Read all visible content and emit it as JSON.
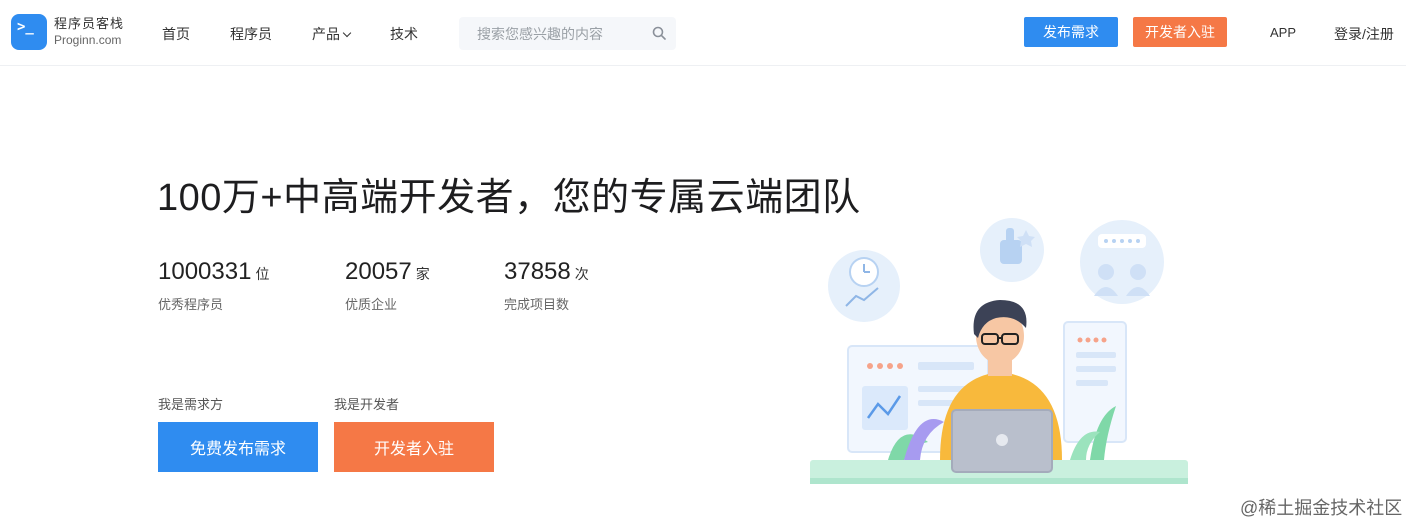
{
  "header": {
    "logo": {
      "name_cn": "程序员客栈",
      "name_en": "Proginn.com",
      "mark_glyph": ">_"
    },
    "nav": [
      {
        "label": "首页"
      },
      {
        "label": "程序员"
      },
      {
        "label": "产品"
      },
      {
        "label": "技术"
      }
    ],
    "search": {
      "placeholder": "搜索您感兴趣的内容",
      "value": ""
    },
    "post_button": "发布需求",
    "join_button": "开发者入驻",
    "app_link": "APP",
    "login_link": "登录/注册"
  },
  "hero": {
    "headline": "100万+中高端开发者，您的专属云端团队",
    "stats": [
      {
        "value": "1000331",
        "unit": "位",
        "label": "优秀程序员"
      },
      {
        "value": "20057",
        "unit": "家",
        "label": "优质企业"
      },
      {
        "value": "37858",
        "unit": "次",
        "label": "完成项目数"
      }
    ],
    "client_label": "我是需求方",
    "developer_label": "我是开发者",
    "client_button": "免费发布需求",
    "developer_button": "开发者入驻"
  },
  "watermark": "@稀土掘金技术社区",
  "colors": {
    "brand_blue": "#2f8cf0",
    "accent_orange": "#f57846"
  }
}
